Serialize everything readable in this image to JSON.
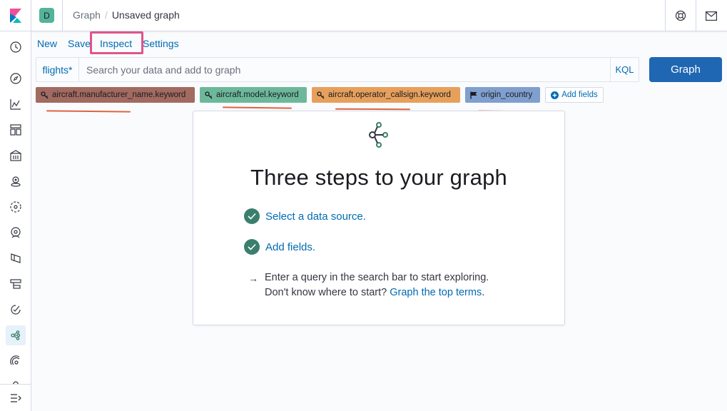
{
  "header": {
    "space_initial": "D",
    "breadcrumbs": [
      "Graph",
      "Unsaved graph"
    ],
    "breadcrumb_separator": "/"
  },
  "topnav": {
    "new_label": "New",
    "save_label": "Save",
    "inspect_label": "Inspect",
    "settings_label": "Settings"
  },
  "search": {
    "index_pattern": "flights*",
    "placeholder": "Search your data and add to graph",
    "language_label": "KQL",
    "submit_label": "Graph"
  },
  "fields": [
    {
      "name": "aircraft.manufacturer_name.keyword",
      "icon": "key-icon",
      "color": "#a26a60"
    },
    {
      "name": "aircraft.model.keyword",
      "icon": "key-icon",
      "color": "#6db89b"
    },
    {
      "name": "aircraft.operator_callsign.keyword",
      "icon": "key-icon",
      "color": "#e7a05c"
    },
    {
      "name": "origin_country",
      "icon": "flag-icon",
      "color": "#7f9fce"
    }
  ],
  "add_fields_label": "Add fields",
  "guide": {
    "title": "Three steps to your graph",
    "step1": "Select a data source.",
    "step2": "Add fields.",
    "step3_line1": "Enter a query in the search bar to start exploring.",
    "step3_prefix": "Don't know where to start? ",
    "step3_link": "Graph the top terms",
    "step3_suffix": "."
  },
  "colors": {
    "primary": "#1f67b3",
    "link": "#006bb4",
    "success": "#3a7f6c",
    "highlight": "#e0548b",
    "annotation": "#d9542b"
  }
}
